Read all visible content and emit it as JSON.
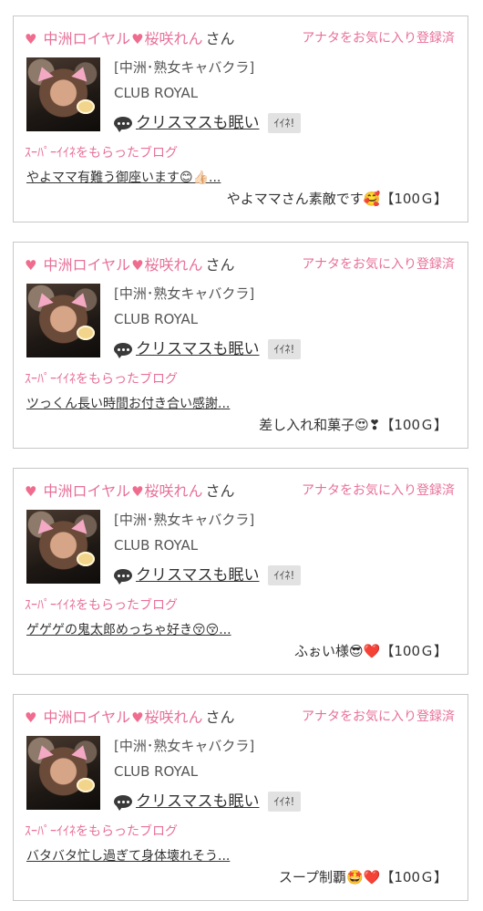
{
  "colors": {
    "accent": "#e8709a",
    "heart": "#f06c8e",
    "border": "#c8c8c8",
    "iine_bg": "#e2e2e2"
  },
  "cards": [
    {
      "shop": "中洲ロイヤル",
      "cast": "桜咲れん",
      "suffix": "さん",
      "favorite": "アナタをお気に入り登録済",
      "genre": "[中洲･熟女キャバクラ]",
      "club": "CLUB ROYAL",
      "blog_title": "クリスマスも眠い",
      "iine": "ｲｲﾈ!",
      "super_like_label": "ｽｰﾊﾟｰｲｲﾈをもらったブログ",
      "post_excerpt": "やよママ有難う御座います😊👍🏻...",
      "comment": "やよママさん素敵です🥰【100Ｇ】"
    },
    {
      "shop": "中洲ロイヤル",
      "cast": "桜咲れん",
      "suffix": "さん",
      "favorite": "アナタをお気に入り登録済",
      "genre": "[中洲･熟女キャバクラ]",
      "club": "CLUB ROYAL",
      "blog_title": "クリスマスも眠い",
      "iine": "ｲｲﾈ!",
      "super_like_label": "ｽｰﾊﾟｰｲｲﾈをもらったブログ",
      "post_excerpt": "ツっくん長い時間お付き合い感謝...",
      "comment": "差し入れ和菓子😍❣【100Ｇ】"
    },
    {
      "shop": "中洲ロイヤル",
      "cast": "桜咲れん",
      "suffix": "さん",
      "favorite": "アナタをお気に入り登録済",
      "genre": "[中洲･熟女キャバクラ]",
      "club": "CLUB ROYAL",
      "blog_title": "クリスマスも眠い",
      "iine": "ｲｲﾈ!",
      "super_like_label": "ｽｰﾊﾟｰｲｲﾈをもらったブログ",
      "post_excerpt": "ゲゲゲの鬼太郎めっちゃ好き😚😚...",
      "comment": "ふぉい様😎❤️【100Ｇ】"
    },
    {
      "shop": "中洲ロイヤル",
      "cast": "桜咲れん",
      "suffix": "さん",
      "favorite": "アナタをお気に入り登録済",
      "genre": "[中洲･熟女キャバクラ]",
      "club": "CLUB ROYAL",
      "blog_title": "クリスマスも眠い",
      "iine": "ｲｲﾈ!",
      "super_like_label": "ｽｰﾊﾟｰｲｲﾈをもらったブログ",
      "post_excerpt": "バタバタ忙し過ぎて身体壊れそう...",
      "comment": "スープ制覇🤩❤️【100Ｇ】"
    }
  ]
}
